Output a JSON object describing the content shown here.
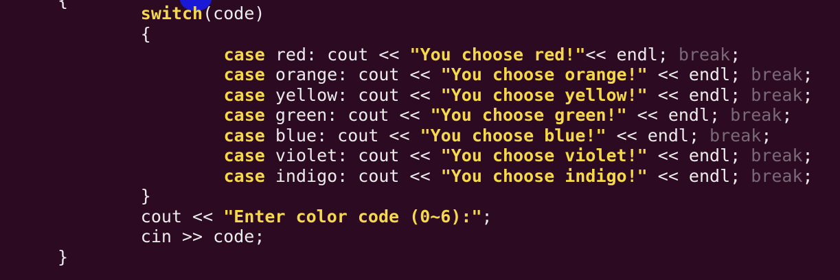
{
  "editor": {
    "lines": [
      {
        "indent": "",
        "segments": [
          {
            "t": "plain",
            "v": "{"
          }
        ]
      },
      {
        "indent": "        ",
        "segments": [
          {
            "t": "kw",
            "v": "switch"
          },
          {
            "t": "plain",
            "v": "(code)"
          }
        ]
      },
      {
        "indent": "        ",
        "segments": [
          {
            "t": "plain",
            "v": "{"
          }
        ]
      },
      {
        "indent": "                ",
        "segments": [
          {
            "t": "kw",
            "v": "case"
          },
          {
            "t": "plain",
            "v": " red: cout << "
          },
          {
            "t": "str",
            "v": "\"You choose red!\""
          },
          {
            "t": "plain",
            "v": "<< endl; "
          },
          {
            "t": "brk",
            "v": "break"
          },
          {
            "t": "plain",
            "v": ";"
          }
        ]
      },
      {
        "indent": "                ",
        "segments": [
          {
            "t": "kw",
            "v": "case"
          },
          {
            "t": "plain",
            "v": " orange: cout << "
          },
          {
            "t": "str",
            "v": "\"You choose orange!\""
          },
          {
            "t": "plain",
            "v": " << endl; "
          },
          {
            "t": "brk",
            "v": "break"
          },
          {
            "t": "plain",
            "v": ";"
          }
        ]
      },
      {
        "indent": "                ",
        "segments": [
          {
            "t": "kw",
            "v": "case"
          },
          {
            "t": "plain",
            "v": " yellow: cout << "
          },
          {
            "t": "str",
            "v": "\"You choose yellow!\""
          },
          {
            "t": "plain",
            "v": " << endl; "
          },
          {
            "t": "brk",
            "v": "break"
          },
          {
            "t": "plain",
            "v": ";"
          }
        ]
      },
      {
        "indent": "                ",
        "segments": [
          {
            "t": "kw",
            "v": "case"
          },
          {
            "t": "plain",
            "v": " green: cout << "
          },
          {
            "t": "str",
            "v": "\"You choose green!\""
          },
          {
            "t": "plain",
            "v": " << endl; "
          },
          {
            "t": "brk",
            "v": "break"
          },
          {
            "t": "plain",
            "v": ";"
          }
        ]
      },
      {
        "indent": "                ",
        "segments": [
          {
            "t": "kw",
            "v": "case"
          },
          {
            "t": "plain",
            "v": " blue: cout << "
          },
          {
            "t": "str",
            "v": "\"You choose blue!\""
          },
          {
            "t": "plain",
            "v": " << endl; "
          },
          {
            "t": "brk",
            "v": "break"
          },
          {
            "t": "plain",
            "v": ";"
          }
        ]
      },
      {
        "indent": "                ",
        "segments": [
          {
            "t": "kw",
            "v": "case"
          },
          {
            "t": "plain",
            "v": " violet: cout << "
          },
          {
            "t": "str",
            "v": "\"You choose violet!\""
          },
          {
            "t": "plain",
            "v": " << endl; "
          },
          {
            "t": "brk",
            "v": "break"
          },
          {
            "t": "plain",
            "v": ";"
          }
        ]
      },
      {
        "indent": "                ",
        "segments": [
          {
            "t": "kw",
            "v": "case"
          },
          {
            "t": "plain",
            "v": " indigo: cout << "
          },
          {
            "t": "str",
            "v": "\"You choose indigo!\""
          },
          {
            "t": "plain",
            "v": " << endl; "
          },
          {
            "t": "brk",
            "v": "break"
          },
          {
            "t": "plain",
            "v": ";"
          }
        ]
      },
      {
        "indent": "        ",
        "segments": [
          {
            "t": "plain",
            "v": "}"
          }
        ]
      },
      {
        "indent": "        ",
        "segments": [
          {
            "t": "plain",
            "v": "cout << "
          },
          {
            "t": "str",
            "v": "\"Enter color code (0~6):\""
          },
          {
            "t": "plain",
            "v": ";"
          }
        ]
      },
      {
        "indent": "        ",
        "segments": [
          {
            "t": "plain",
            "v": "cin >> code;"
          }
        ]
      },
      {
        "indent": "",
        "segments": [
          {
            "t": "plain",
            "v": "}"
          }
        ]
      }
    ]
  },
  "colors": {
    "background": "#2c0a22",
    "keyword": "#f6d94a",
    "string": "#f6d94a",
    "text": "#ececec",
    "break_keyword": "#7a6a78",
    "cursor_highlight": "#1a1ad6"
  }
}
